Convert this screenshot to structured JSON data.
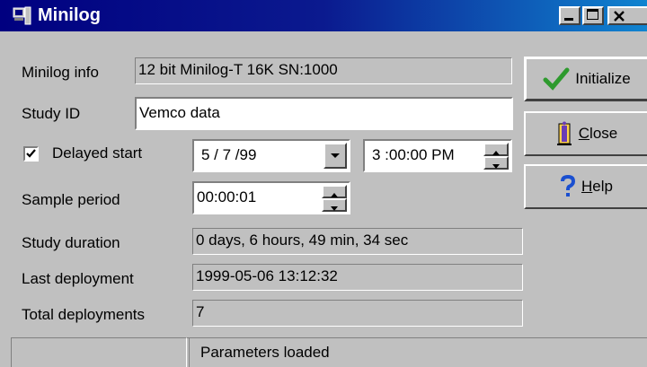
{
  "window": {
    "title": "Minilog"
  },
  "fields": {
    "minilog_info_label": "Minilog info",
    "minilog_info_value": "12 bit Minilog-T 16K SN:1000",
    "study_id_label": "Study ID",
    "study_id_value": "Vemco data",
    "delayed_start_label": "Delayed start",
    "delayed_start_checked": true,
    "delayed_start_date": "5 / 7 /99",
    "delayed_start_time": "3 :00:00 PM",
    "sample_period_label": "Sample period",
    "sample_period_value": "00:00:01",
    "study_duration_label": "Study duration",
    "study_duration_value": "0 days, 6 hours, 49 min, 34 sec",
    "last_deployment_label": "Last deployment",
    "last_deployment_value": "1999-05-06 13:12:32",
    "total_deployments_label": "Total deployments",
    "total_deployments_value": "7"
  },
  "buttons": {
    "initialize": "Initialize",
    "close_mnemonic": "C",
    "close_rest": "lose",
    "help_mnemonic": "H",
    "help_rest": "elp"
  },
  "status": {
    "message": "Parameters loaded"
  },
  "icons": {
    "app": "minilog-app-icon",
    "initialize": "checkmark-icon",
    "close": "door-exit-icon",
    "help": "question-mark-icon"
  },
  "colors": {
    "titlebar": "#000080",
    "face": "#c0c0c0",
    "check": "#2e9a2e",
    "help": "#1a4fd0"
  }
}
